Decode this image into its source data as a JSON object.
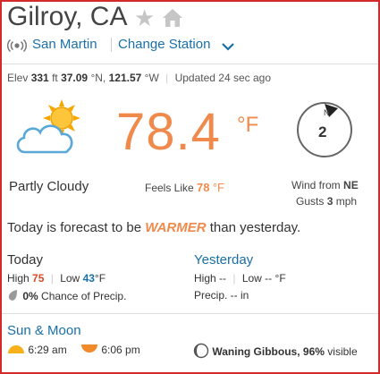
{
  "header": {
    "city": "Gilroy, CA",
    "star_icon": "star-icon",
    "home_icon": "home-icon"
  },
  "station": {
    "name": "San Martin",
    "change_label": "Change Station"
  },
  "meta": {
    "elev_label": "Elev",
    "elev_value": "331",
    "elev_unit": "ft",
    "lat": "37.09",
    "lat_dir": "°N,",
    "lon": "121.57",
    "lon_dir": "°W",
    "updated": "Updated 24 sec ago"
  },
  "current": {
    "temperature": "78.4",
    "unit": "°F",
    "condition": "Partly Cloudy",
    "feels_label": "Feels Like",
    "feels_value": "78",
    "feels_unit": "°F"
  },
  "wind": {
    "speed": "2",
    "compass_n": "N",
    "from_label": "Wind from",
    "from_dir": "NE",
    "gusts_label": "Gusts",
    "gusts_value": "3",
    "gusts_unit": "mph"
  },
  "forecast": {
    "before": "Today is forecast to be",
    "emphasis": "WARMER",
    "after": "than yesterday."
  },
  "today": {
    "title": "Today",
    "high_label": "High",
    "high_value": "75",
    "low_label": "Low",
    "low_value": "43",
    "low_unit": "°F",
    "precip_value": "0%",
    "precip_label": "Chance of Precip."
  },
  "yesterday": {
    "title": "Yesterday",
    "high": "High --",
    "low": "Low --",
    "low_unit": "°F",
    "precip": "Precip. -- in"
  },
  "sun_moon": {
    "title": "Sun & Moon",
    "sunrise": "6:29 am",
    "sunset": "6:06 pm",
    "moon_phase": "Waning Gibbous,",
    "moon_visible_value": "96%",
    "moon_visible_label": "visible"
  },
  "colors": {
    "accent_orange": "#ef8a4c",
    "link_blue": "#1a6fa8",
    "high_red": "#d9482a",
    "frame_red": "#d42a2a"
  }
}
